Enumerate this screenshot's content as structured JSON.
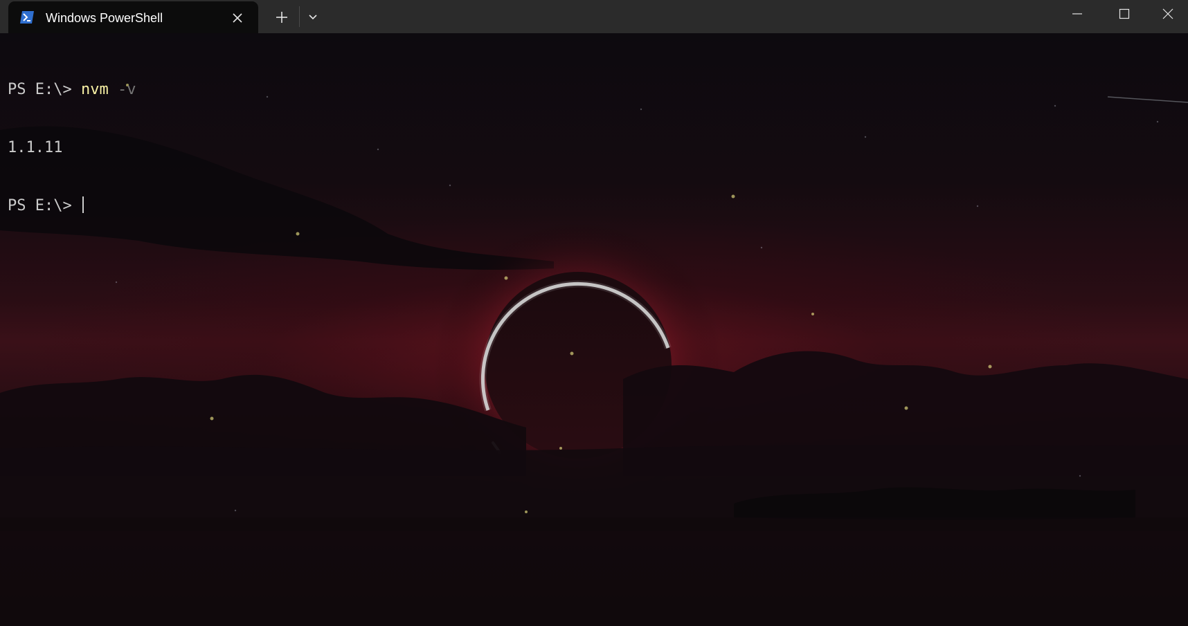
{
  "window": {
    "tab_title": "Windows PowerShell",
    "tab_icon": "powershell-icon",
    "tab_close_icon": "close-icon",
    "new_tab_icon": "plus-icon",
    "dropdown_icon": "chevron-down-icon",
    "minimize_icon": "minimize-icon",
    "maximize_icon": "maximize-icon",
    "close_icon": "close-icon"
  },
  "terminal": {
    "lines": [
      {
        "prompt": "PS E:\\> ",
        "command": "nvm",
        "args": " -v"
      },
      {
        "output": "1.1.11"
      },
      {
        "prompt": "PS E:\\> ",
        "cursor": true
      }
    ]
  },
  "colors": {
    "titlebar": "#2b2b2b",
    "active_tab": "#0c0c0c",
    "text": "#cccccc",
    "command": "#f9f1a5",
    "parameter": "#767676",
    "background": "#120a0d",
    "accent_glow": "#7a1220"
  }
}
